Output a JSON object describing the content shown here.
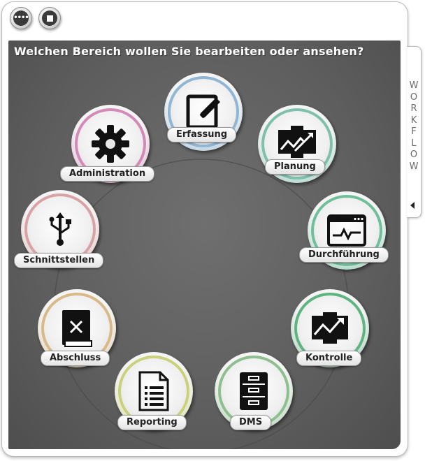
{
  "toolbar": {
    "more_glyph": "••••",
    "more_icon": "more-icon",
    "stop_icon": "stop-icon"
  },
  "panel": {
    "title": "Welchen Bereich wollen Sie bearbeiten oder ansehen?"
  },
  "nodes": [
    {
      "label": "Erfassung",
      "icon": "edit-icon",
      "color": "#8fb6d4"
    },
    {
      "label": "Planung",
      "icon": "chart-board-icon",
      "color": "#7fc0ad"
    },
    {
      "label": "Durchführung",
      "icon": "monitor-pulse-icon",
      "color": "#6fbf9a"
    },
    {
      "label": "Kontrolle",
      "icon": "trend-chart-icon",
      "color": "#5fb582"
    },
    {
      "label": "DMS",
      "icon": "filing-cabinet-icon",
      "color": "#8dbf8f"
    },
    {
      "label": "Reporting",
      "icon": "document-icon",
      "color": "#c9d17a"
    },
    {
      "label": "Abschluss",
      "icon": "closed-book-icon",
      "color": "#d9b98a"
    },
    {
      "label": "Schnittstellen",
      "icon": "usb-icon",
      "color": "#d9a3a6"
    },
    {
      "label": "Administration",
      "icon": "gear-icon",
      "color": "#d48ab8"
    }
  ],
  "workflow_tab": {
    "letters": [
      "W",
      "O",
      "R",
      "K",
      "F",
      "L",
      "O",
      "W"
    ],
    "arrow_icon": "arrow-left-icon"
  }
}
